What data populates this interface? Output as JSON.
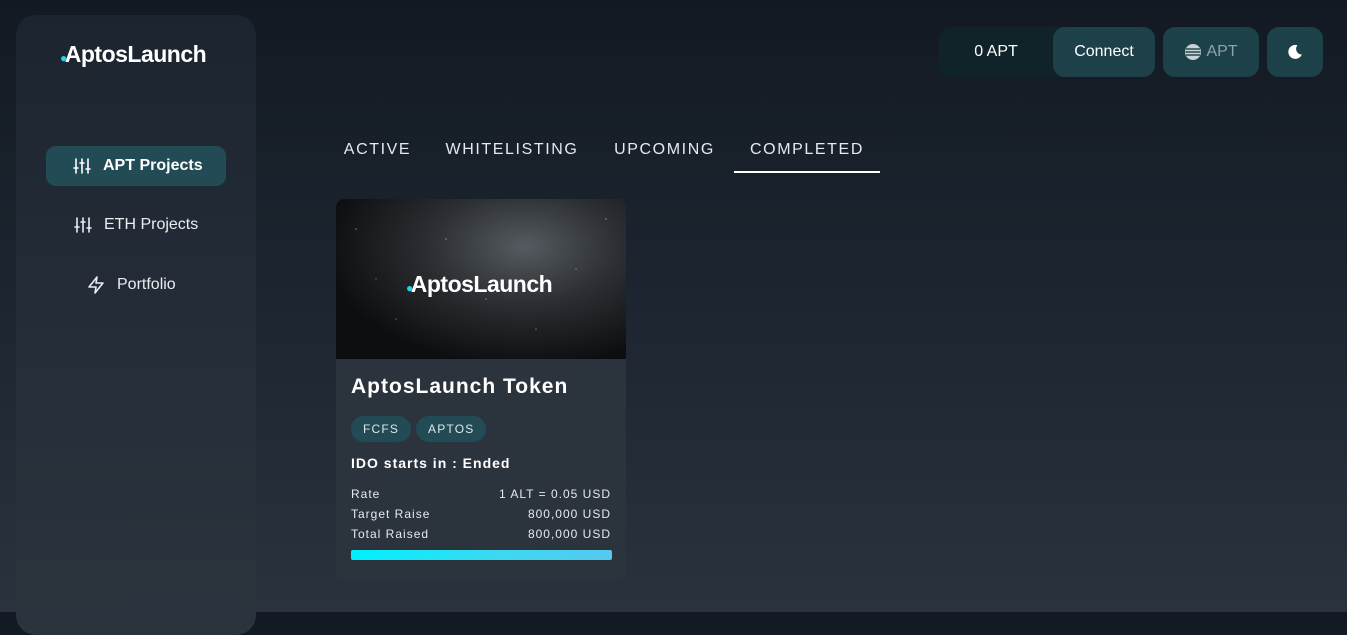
{
  "app": {
    "logo": "AptosLaunch"
  },
  "sidebar": {
    "items": [
      {
        "label": "APT Projects",
        "icon": "sliders-icon",
        "active": true
      },
      {
        "label": "ETH Projects",
        "icon": "sliders-icon",
        "active": false
      },
      {
        "label": "Portfolio",
        "icon": "lightning-icon",
        "active": false
      }
    ]
  },
  "header": {
    "balance": "0 APT",
    "connect_label": "Connect",
    "network_label": "APT",
    "network_icon": "aptos-icon",
    "theme_icon": "moon-icon"
  },
  "tabs": [
    {
      "label": "ACTIVE",
      "active": false
    },
    {
      "label": "WHITELISTING",
      "active": false
    },
    {
      "label": "UPCOMING",
      "active": false
    },
    {
      "label": "COMPLETED",
      "active": true
    }
  ],
  "projects": [
    {
      "banner_logo": "AptosLaunch",
      "title": "AptosLaunch Token",
      "tags": [
        "FCFS",
        "APTOS"
      ],
      "ido_status": "IDO starts in : Ended",
      "rows": [
        {
          "label": "Rate",
          "value": "1 ALT = 0.05 USD"
        },
        {
          "label": "Target Raise",
          "value": "800,000 USD"
        },
        {
          "label": "Total Raised",
          "value": "800,000 USD"
        }
      ],
      "progress_fraction": 1.0
    }
  ],
  "colors": {
    "accent": "#20d5e6",
    "active_nav_bg": "#234b55",
    "progress_start": "#00f0ff",
    "progress_end": "#55c8f0"
  }
}
